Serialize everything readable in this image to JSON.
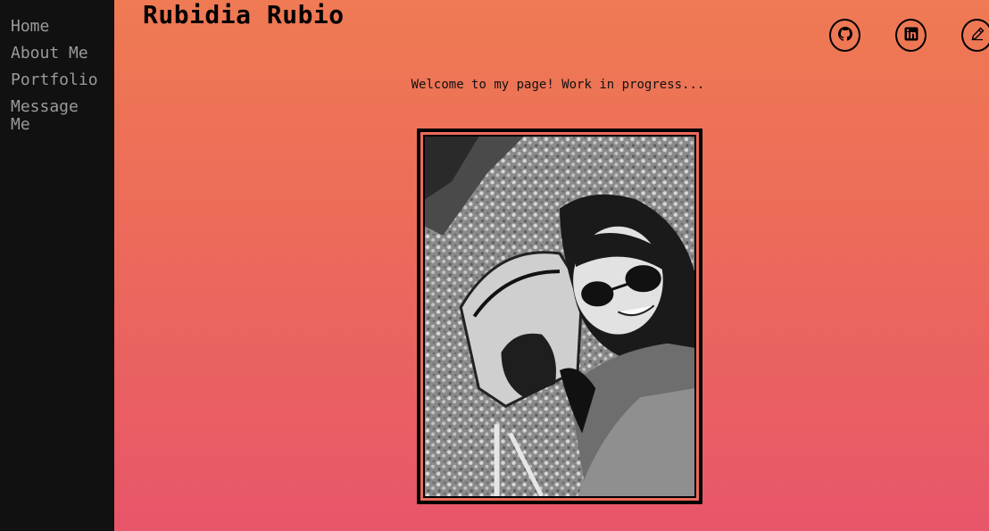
{
  "nav": {
    "items": [
      {
        "label": "Home"
      },
      {
        "label": "About Me"
      },
      {
        "label": "Portfolio"
      },
      {
        "label": "Message Me"
      }
    ]
  },
  "header": {
    "title": "Rubidia Rubio"
  },
  "socials": [
    {
      "icon": "github-icon"
    },
    {
      "icon": "linkedin-icon"
    },
    {
      "icon": "pencil-icon"
    }
  ],
  "main": {
    "welcome": "Welcome to my page! Work in progress..."
  },
  "colors": {
    "sidebar_bg": "#111111",
    "nav_text": "#9a9a9a",
    "gradient_top": "#ef7a53",
    "gradient_bottom": "#e8566a"
  }
}
